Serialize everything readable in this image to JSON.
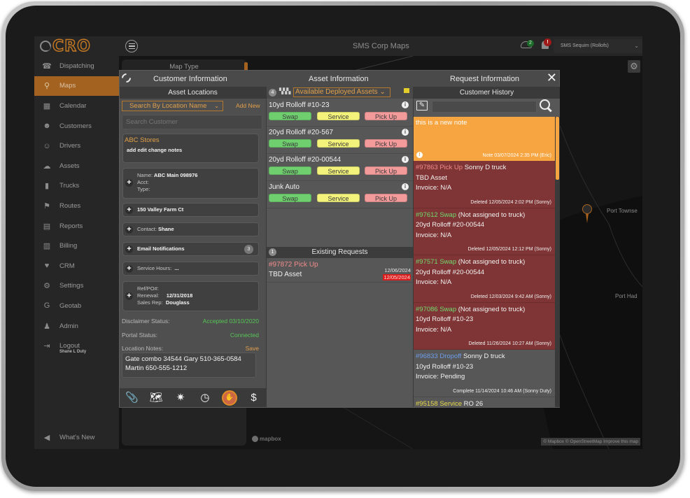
{
  "app": {
    "logo_text": "CRO",
    "title": "SMS Corp Maps",
    "sync_badge": "2",
    "alert_badge": "!",
    "company_select": "SMS Sequim (Rollofs)",
    "accent_color": "#a36220"
  },
  "sidebar": {
    "items": [
      {
        "label": "Dispatching",
        "icon": "dispatch-icon",
        "glyph": "☎"
      },
      {
        "label": "Maps",
        "icon": "map-icon",
        "glyph": "⚲",
        "active": true
      },
      {
        "label": "Calendar",
        "icon": "calendar-icon",
        "glyph": "▦"
      },
      {
        "label": "Customers",
        "icon": "customers-icon",
        "glyph": "☻"
      },
      {
        "label": "Drivers",
        "icon": "drivers-icon",
        "glyph": "☺"
      },
      {
        "label": "Assets",
        "icon": "assets-icon",
        "glyph": "☁"
      },
      {
        "label": "Trucks",
        "icon": "truck-icon",
        "glyph": "▮"
      },
      {
        "label": "Routes",
        "icon": "routes-icon",
        "glyph": "⚑"
      },
      {
        "label": "Reports",
        "icon": "reports-icon",
        "glyph": "▤"
      },
      {
        "label": "Billing",
        "icon": "billing-icon",
        "glyph": "▥"
      },
      {
        "label": "CRM",
        "icon": "crm-icon",
        "glyph": "♥"
      },
      {
        "label": "Settings",
        "icon": "settings-icon",
        "glyph": "⚙"
      },
      {
        "label": "Geotab",
        "icon": "geotab-icon",
        "glyph": "G"
      },
      {
        "label": "Admin",
        "icon": "admin-icon",
        "glyph": "♟"
      },
      {
        "label": "Logout",
        "icon": "logout-icon",
        "glyph": "⇥"
      }
    ],
    "logged_in_user": "Shane L Duty",
    "whats_new": "What's New"
  },
  "map": {
    "map_type_label": "Map Type",
    "labels": [
      "Port Townse",
      "Port Had"
    ],
    "mapbox_logo": "mapbox",
    "attribution": "© Mapbox © OpenStreetMap  Improve this map"
  },
  "modal": {
    "customer_header": "Customer Information",
    "asset_header": "Asset Information",
    "request_header": "Request Information",
    "customer": {
      "subheader": "Asset Locations",
      "search_mode": "Search By Location Name",
      "add_new": "Add New",
      "search_placeholder": "Search Customer",
      "customer_name": "ABC Stores",
      "customer_notes": "add edit change notes",
      "location": {
        "name_label": "Name:",
        "name": "ABC Main 098976",
        "acct_label": "Acct:",
        "type_label": "Type:"
      },
      "address": "150 Valley Farm Ct",
      "contact_label": "Contact:",
      "contact": "Shane",
      "email_notifications": "Email Notifications",
      "email_count": "3",
      "service_hours_label": "Service Hours:",
      "service_hours": "...",
      "ref_label": "Ref/PO#:",
      "renewal_label": "Renewal:",
      "renewal": "12/31/2018",
      "sales_rep_label": "Sales Rep:",
      "sales_rep": "Douglass",
      "disclaimer_label": "Disclaimer Status:",
      "disclaimer_value": "Accepted 03/10/2020",
      "portal_label": "Portal Status:",
      "portal_value": "Connected",
      "location_notes_label": "Location Notes:",
      "save_label": "Save",
      "location_notes": "Gate combo 34544 Gary 510-365-0584 Martin 650-555-1212",
      "tools": [
        {
          "icon": "attachment-icon",
          "glyph": "📎"
        },
        {
          "icon": "map-route-icon",
          "glyph": "🗺"
        },
        {
          "icon": "network-icon",
          "glyph": "✷"
        },
        {
          "icon": "clock-icon",
          "glyph": "◷"
        },
        {
          "icon": "stop-service-icon",
          "glyph": "✋"
        },
        {
          "icon": "dollar-icon",
          "glyph": "$"
        }
      ]
    },
    "assets": {
      "count": "4",
      "filter": "Available Deployed Assets",
      "items": [
        {
          "name": "10yd Rolloff #10-23"
        },
        {
          "name": "20yd Rolloff #20-567"
        },
        {
          "name": "20yd Rolloff #20-00544"
        },
        {
          "name": "Junk Auto"
        }
      ],
      "actions": {
        "swap": "Swap",
        "service": "Service",
        "pickup": "Pick Up"
      },
      "existing_requests_count": "1",
      "existing_requests_label": "Existing Requests",
      "requests": [
        {
          "id": "#97872 Pick Up",
          "asset": "TBD Asset",
          "date1": "12/06/2024",
          "date2": "12/05/2024"
        }
      ]
    },
    "history": {
      "subheader": "Customer History",
      "note": {
        "text": "this is a new note",
        "meta": "Note 03/07/2024 2:35 PM (Eric)"
      },
      "entries": [
        {
          "id": "#97863 Pick Up",
          "type": "pick",
          "rest": " Sonny D truck",
          "line2": "TBD Asset",
          "line3": "Invoice: N/A",
          "meta": "Deleted 12/05/2024 2:02 PM (Sonny)",
          "status": "deleted"
        },
        {
          "id": "#97612 Swap",
          "type": "swap",
          "rest": " (Not assigned to truck)",
          "line2": "20yd Rolloff #20-00544",
          "line3": "Invoice: N/A",
          "meta": "Deleted 12/05/2024 12:12 PM (Sonny)",
          "status": "deleted"
        },
        {
          "id": "#97571 Swap",
          "type": "swap",
          "rest": " (Not assigned to truck)",
          "line2": "20yd Rolloff #20-00544",
          "line3": "Invoice: N/A",
          "meta": "Deleted 12/03/2024 9:42 AM (Sonny)",
          "status": "deleted"
        },
        {
          "id": "#97086 Swap",
          "type": "swap",
          "rest": " (Not assigned to truck)",
          "line2": "10yd Rolloff #10-23",
          "line3": "Invoice: N/A",
          "meta": "Deleted 11/26/2024 10:27 AM (Sonny)",
          "status": "deleted"
        },
        {
          "id": "#96833 Dropoff",
          "type": "drop",
          "rest": " Sonny D truck",
          "line2": "10yd Rolloff #10-23",
          "line3": "Invoice: Pending",
          "meta": "Complete 11/14/2024 10:46 AM (Sonny Duty)",
          "status": "complete"
        },
        {
          "id": "#95158 Service",
          "type": "svc",
          "rest": " RO 26",
          "line2": "",
          "line3": "",
          "meta": "",
          "status": "complete"
        }
      ]
    }
  }
}
